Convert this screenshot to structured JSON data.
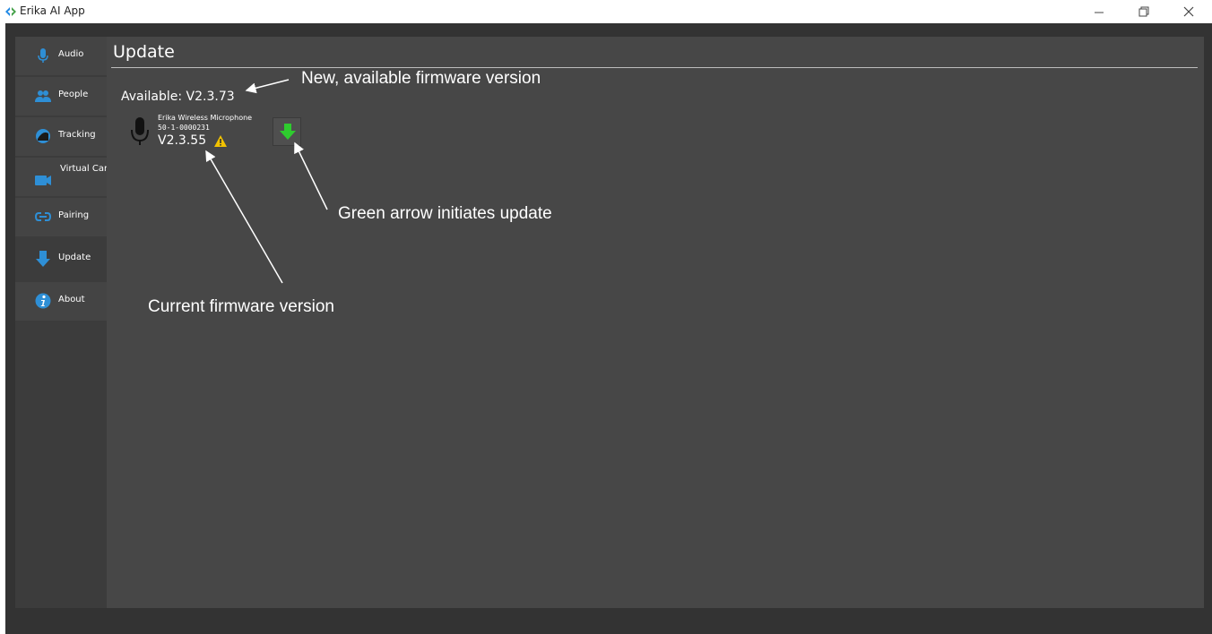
{
  "window": {
    "title": "Erika AI App",
    "minimize_icon": "minimize-icon",
    "maximize_icon": "restore-icon",
    "close_icon": "close-icon"
  },
  "sidebar": {
    "items": [
      {
        "label": "Audio",
        "icon": "microphone-icon",
        "active": false
      },
      {
        "label": "People",
        "icon": "people-icon",
        "active": false
      },
      {
        "label": "Tracking",
        "icon": "tracking-icon",
        "active": false
      },
      {
        "label": "Virtual Camera",
        "icon": "camera-icon",
        "active": false
      },
      {
        "label": "Pairing",
        "icon": "pairing-icon",
        "active": false
      },
      {
        "label": "Update",
        "icon": "download-arrow-icon",
        "active": true
      },
      {
        "label": "About",
        "icon": "info-icon",
        "active": false
      }
    ]
  },
  "main": {
    "title": "Update",
    "available": "Available: V2.3.73",
    "device": {
      "name": "Erika Wireless Microphone",
      "serial": "50-1-0000231",
      "version": "V2.3.55",
      "status_icon": "warning-icon"
    },
    "update_button_icon": "green-download-arrow-icon"
  },
  "annotations": {
    "new_version": "New, available firmware version",
    "green_arrow": "Green arrow initiates update",
    "current_version": "Current firmware version"
  },
  "colors": {
    "accent_blue": "#2e8fd6",
    "update_green": "#2ecc2e",
    "warning_yellow": "#f2c200",
    "panel_bg": "#474747",
    "sidebar_bg": "#444444",
    "frame_bg": "#333333"
  }
}
